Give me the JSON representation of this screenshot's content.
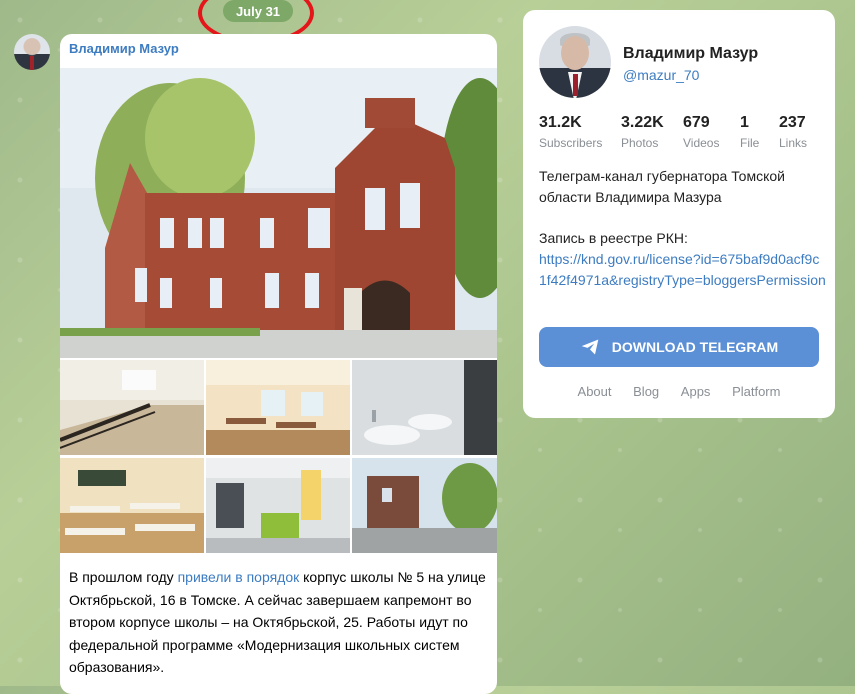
{
  "date_badge": "July 31",
  "message": {
    "author": "Владимир Мазур",
    "text_before_link": "В прошлом году ",
    "link_text": "привели в порядок",
    "text_after_link": " корпус школы № 5 на улице Октябрьской, 16 в Томске. А сейчас завершаем капремонт во втором корпусе школы – на Октябрьской, 25. Работы идут по федеральной программе «Модернизация школьных систем образования»."
  },
  "channel": {
    "name": "Владимир Мазур",
    "handle": "@mazur_70",
    "stats": [
      {
        "value": "31.2K",
        "label": "Subscribers"
      },
      {
        "value": "3.22K",
        "label": "Photos"
      },
      {
        "value": "679",
        "label": "Videos"
      },
      {
        "value": "1",
        "label": "File"
      },
      {
        "value": "237",
        "label": "Links"
      }
    ],
    "description": "Телеграм-канал губернатора Томской области Владимира Мазура",
    "rkn_label": "Запись в реестре РКН:",
    "rkn_link": "https://knd.gov.ru/license?id=675baf9d0acf9c1f42f4971a&registryType=bloggersPermission",
    "download_button": "DOWNLOAD TELEGRAM",
    "footer_links": [
      "About",
      "Blog",
      "Apps",
      "Platform"
    ]
  },
  "colors": {
    "accent": "#5b8fd6",
    "link": "#3d7cc1",
    "date_badge": "#7da867",
    "highlight_ring": "#e4161a"
  },
  "icons": {
    "download_button_icon": "paper-plane-icon"
  }
}
